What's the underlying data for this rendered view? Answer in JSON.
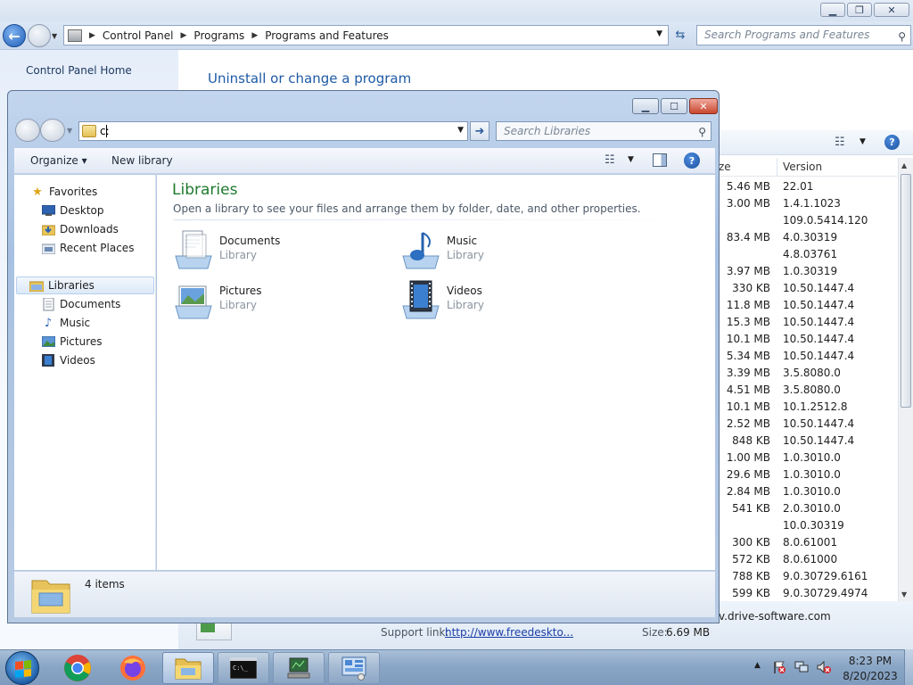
{
  "control_panel": {
    "breadcrumb": [
      "Control Panel",
      "Programs",
      "Programs and Features"
    ],
    "search_placeholder": "Search Programs and Features",
    "left_link": "Control Panel Home",
    "heading": "Uninstall or change a program",
    "columns": {
      "size": "ze",
      "version": "Version"
    },
    "rows": [
      {
        "size": "5.46 MB",
        "version": "22.01"
      },
      {
        "size": "3.00 MB",
        "version": "1.4.1.1023"
      },
      {
        "size": "",
        "version": "109.0.5414.120"
      },
      {
        "size": "83.4 MB",
        "version": "4.0.30319"
      },
      {
        "size": "",
        "version": "4.8.03761"
      },
      {
        "size": "3.97 MB",
        "version": "1.0.30319"
      },
      {
        "size": "330 KB",
        "version": "10.50.1447.4"
      },
      {
        "size": "11.8 MB",
        "version": "10.50.1447.4"
      },
      {
        "size": "15.3 MB",
        "version": "10.50.1447.4"
      },
      {
        "size": "10.1 MB",
        "version": "10.50.1447.4"
      },
      {
        "size": "5.34 MB",
        "version": "10.50.1447.4"
      },
      {
        "size": "3.39 MB",
        "version": "3.5.8080.0"
      },
      {
        "size": "4.51 MB",
        "version": "3.5.8080.0"
      },
      {
        "size": "10.1 MB",
        "version": "10.1.2512.8"
      },
      {
        "size": "2.52 MB",
        "version": "10.50.1447.4"
      },
      {
        "size": "848 KB",
        "version": "10.50.1447.4"
      },
      {
        "size": "1.00 MB",
        "version": "1.0.3010.0"
      },
      {
        "size": "29.6 MB",
        "version": "1.0.3010.0"
      },
      {
        "size": "2.84 MB",
        "version": "1.0.3010.0"
      },
      {
        "size": "541 KB",
        "version": "2.0.3010.0"
      },
      {
        "size": "",
        "version": "10.0.30319"
      },
      {
        "size": "300 KB",
        "version": "8.0.61001"
      },
      {
        "size": "572 KB",
        "version": "8.0.61000"
      },
      {
        "size": "788 KB",
        "version": "9.0.30729.6161"
      },
      {
        "size": "599 KB",
        "version": "9.0.30729.4974"
      }
    ],
    "details": {
      "publisher_fragment": "v.drive-software.com",
      "support_label": "Support link:",
      "support_link": "http://www.freedeskto...",
      "size_label": "Size:",
      "size_value": "6.69 MB"
    }
  },
  "libraries_window": {
    "address_value": "c:",
    "search_placeholder": "Search Libraries",
    "toolbar": {
      "organize": "Organize",
      "new_library": "New library"
    },
    "nav": {
      "favorites_header": "Favorites",
      "favorites": [
        "Desktop",
        "Downloads",
        "Recent Places"
      ],
      "libraries_header": "Libraries",
      "libraries": [
        "Documents",
        "Music",
        "Pictures",
        "Videos"
      ]
    },
    "title": "Libraries",
    "subtitle": "Open a library to see your files and arrange them by folder, date, and other properties.",
    "tiles": [
      {
        "name": "Documents",
        "type": "Library",
        "icon": "documents-library-icon"
      },
      {
        "name": "Music",
        "type": "Library",
        "icon": "music-library-icon"
      },
      {
        "name": "Pictures",
        "type": "Library",
        "icon": "pictures-library-icon"
      },
      {
        "name": "Videos",
        "type": "Library",
        "icon": "videos-library-icon"
      }
    ],
    "status": "4 items"
  },
  "taskbar": {
    "pinned": [
      "chrome-icon",
      "firefox-icon",
      "explorer-icon",
      "cmd-icon",
      "network-icon",
      "control-panel-icon"
    ],
    "clock_time": "8:23 PM",
    "clock_date": "8/20/2023"
  }
}
